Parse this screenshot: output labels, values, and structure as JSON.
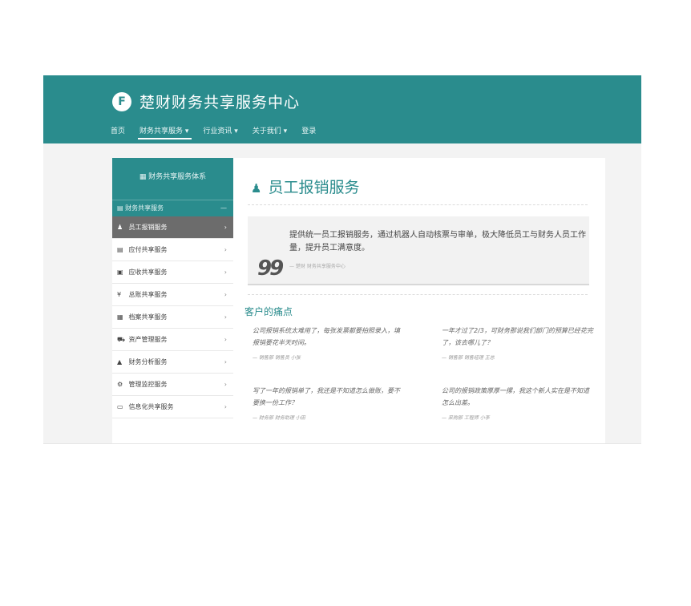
{
  "header": {
    "logo_letter": "F",
    "title": "楚财财务共享服务中心"
  },
  "nav": [
    {
      "label": "首页"
    },
    {
      "label": "财务共享服务 ▾"
    },
    {
      "label": "行业资讯 ▾"
    },
    {
      "label": "关于我们 ▾"
    },
    {
      "label": "登录"
    }
  ],
  "sidebar": {
    "heading": "▦  财务共享服务体系",
    "group": {
      "label": "▤ 财务共享服务",
      "toggle": "—"
    },
    "items": [
      {
        "icon": "♟",
        "label": "员工报销服务",
        "chev": "›"
      },
      {
        "icon": "▤",
        "label": "应付共享服务",
        "chev": "›"
      },
      {
        "icon": "▣",
        "label": "应收共享服务",
        "chev": "›"
      },
      {
        "icon": "¥",
        "label": "总账共享服务",
        "chev": "›"
      },
      {
        "icon": "▦",
        "label": "档案共享服务",
        "chev": "›"
      },
      {
        "icon": "⛟",
        "label": "资产管理服务",
        "chev": "›"
      },
      {
        "icon": "▲",
        "label": "财务分析服务",
        "chev": "›"
      },
      {
        "icon": "⚙",
        "label": "管理监控服务",
        "chev": "›"
      },
      {
        "icon": "▭",
        "label": "信息化共享服务",
        "chev": "›"
      }
    ]
  },
  "main": {
    "title_icon": "♟",
    "title": "员工报销服务",
    "quote": {
      "mark": "99",
      "text": "提供统一员工报销服务，通过机器人自动核票与审单，极大降低员工与财务人员工作量，提升员工满意度。",
      "source": "— 楚财 财务共享服务中心"
    },
    "pain_title": "客户的痛点",
    "pain_points": [
      {
        "text": "公司报销系统太难用了，每张发票都要拍照录入，填报销要花半天时间。",
        "source": "— 销售部 销售员 小张"
      },
      {
        "text": "一年才过了2/3，可财务那说我们部门的预算已经花完了，该去哪儿了？",
        "source": "— 销售部 销售经理 王总"
      },
      {
        "text": "写了一年的报销单了，我还是不知道怎么做账，要不要换一份工作？",
        "source": "— 财务部 财务助理 小田"
      },
      {
        "text": "公司的报销政策厚厚一摞，我这个新人实在是不知道怎么出差。",
        "source": "— 采购部 工程师 小李"
      }
    ]
  }
}
